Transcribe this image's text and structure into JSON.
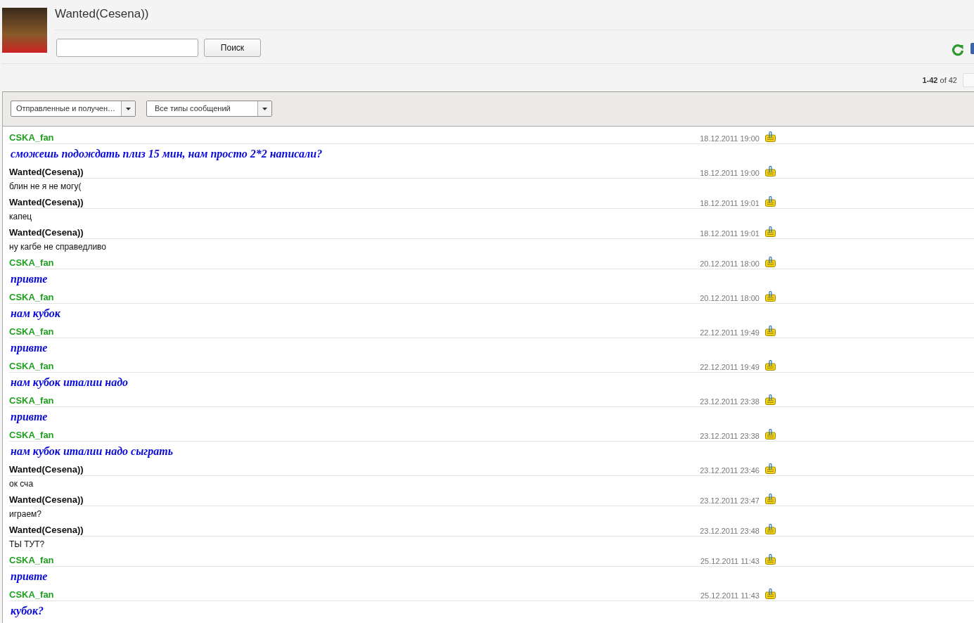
{
  "contact": {
    "name": "Wanted(Cesena))"
  },
  "search": {
    "button": "Поиск"
  },
  "pager": {
    "summary": "**1-42** of 42"
  },
  "filters": [
    {
      "value": "Отправленные и получен…"
    },
    {
      "value": "Все типы сообщений"
    }
  ],
  "messages": [
    {
      "author": "CSKA_fan",
      "kind": "styled",
      "time": "18.12.2011 19:00",
      "text": "сможешь подождать плиз 15 мин, нам просто 2*2 написали?"
    },
    {
      "author": "Wanted(Cesena))",
      "kind": "plain",
      "time": "18.12.2011 19:00",
      "text": "блин не я не могу("
    },
    {
      "author": "Wanted(Cesena))",
      "kind": "plain",
      "time": "18.12.2011 19:01",
      "text": "капец"
    },
    {
      "author": "Wanted(Cesena))",
      "kind": "plain",
      "time": "18.12.2011 19:01",
      "text": "ну кагбе не справедливо"
    },
    {
      "author": "CSKA_fan",
      "kind": "styled",
      "time": "20.12.2011 18:00",
      "text": "привте"
    },
    {
      "author": "CSKA_fan",
      "kind": "styled",
      "time": "20.12.2011 18:00",
      "text": "нам кубок"
    },
    {
      "author": "CSKA_fan",
      "kind": "styled",
      "time": "22.12.2011 19:49",
      "text": "привте"
    },
    {
      "author": "CSKA_fan",
      "kind": "styled",
      "time": "22.12.2011 19:49",
      "text": "нам кубок италии надо"
    },
    {
      "author": "CSKA_fan",
      "kind": "styled",
      "time": "23.12.2011 23:38",
      "text": "привте"
    },
    {
      "author": "CSKA_fan",
      "kind": "styled",
      "time": "23.12.2011 23:38",
      "text": "нам кубок италии надо сыграть"
    },
    {
      "author": "Wanted(Cesena))",
      "kind": "plain",
      "time": "23.12.2011 23:46",
      "text": "ок сча"
    },
    {
      "author": "Wanted(Cesena))",
      "kind": "plain",
      "time": "23.12.2011 23:47",
      "text": "играем?"
    },
    {
      "author": "Wanted(Cesena))",
      "kind": "plain",
      "time": "23.12.2011 23:48",
      "text": "ТЫ ТУТ?"
    },
    {
      "author": "CSKA_fan",
      "kind": "styled",
      "time": "25.12.2011 11:43",
      "text": "привте"
    },
    {
      "author": "CSKA_fan",
      "kind": "styled",
      "time": "25.12.2011 11:43",
      "text": "кубок?"
    }
  ]
}
